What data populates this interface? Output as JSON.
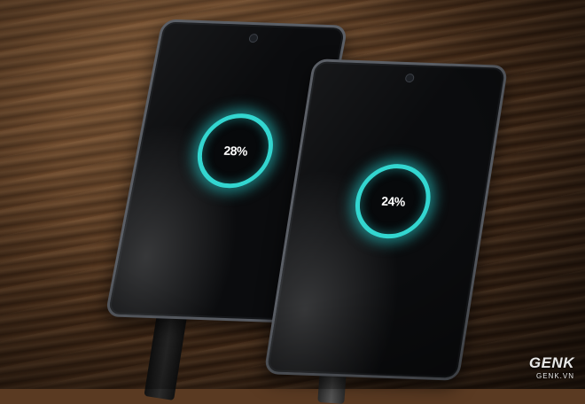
{
  "scene": {
    "subject": "two smartphones charging on wooden table",
    "colors": {
      "ring": "#33d6d0",
      "screen": "#07090b",
      "wood": "#4a2d18"
    }
  },
  "phones": [
    {
      "charge_label": "28%",
      "charge_level": 28
    },
    {
      "charge_label": "24%",
      "charge_level": 24
    }
  ],
  "watermark": {
    "logo": "GENK",
    "domain": "GENK.VN"
  }
}
